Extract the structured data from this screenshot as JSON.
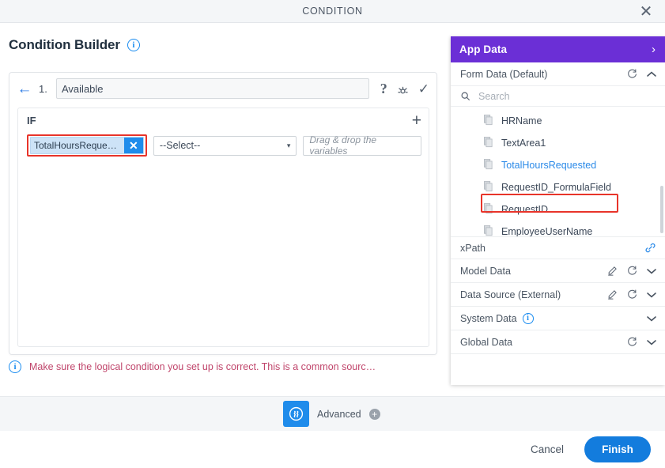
{
  "window": {
    "title": "CONDITION",
    "close_label": "✕"
  },
  "left": {
    "page_title": "Condition Builder",
    "info_icon": "i",
    "condition": {
      "back_icon": "←",
      "index": "1.",
      "name_value": "Available",
      "name_placeholder": "",
      "help_icon": "?",
      "debug_icon": "debug-icon",
      "confirm_icon": "✓",
      "if_label": "IF",
      "add_icon": "+",
      "variable_chip": "TotalHoursReque…",
      "chip_remove": "✕",
      "operator_value": "--Select--",
      "operator_caret": "▾",
      "value_placeholder": "Drag & drop the variables"
    },
    "warning": {
      "icon": "i",
      "text": "Make sure the logical condition you set up is correct. This is a common sourc…"
    }
  },
  "app_data": {
    "header": {
      "title": "App Data",
      "chevron": "›"
    },
    "form_data": {
      "label": "Form Data (Default)",
      "refresh_icon": "refresh-icon",
      "chevron": "⌃",
      "search_placeholder": "Search",
      "search_value": "",
      "items": [
        {
          "label": "HRName",
          "highlighted": false
        },
        {
          "label": "TextArea1",
          "highlighted": false
        },
        {
          "label": "TotalHoursRequested",
          "highlighted": true
        },
        {
          "label": "RequestID_FormulaField",
          "highlighted": false
        },
        {
          "label": "RequestID",
          "highlighted": false
        },
        {
          "label": "EmployeeUserName",
          "highlighted": false
        }
      ]
    },
    "xpath": {
      "label": "xPath",
      "link_icon": "link-icon"
    },
    "sections": [
      {
        "label": "Model Data",
        "has_edit": true,
        "has_refresh": true,
        "has_info": false,
        "chevron": "⌄"
      },
      {
        "label": "Data Source (External)",
        "has_edit": true,
        "has_refresh": true,
        "has_info": false,
        "chevron": "⌄"
      },
      {
        "label": "System Data",
        "has_edit": false,
        "has_refresh": false,
        "has_info": true,
        "chevron": "⌄"
      },
      {
        "label": "Global Data",
        "has_edit": false,
        "has_refresh": true,
        "has_info": false,
        "chevron": "⌄"
      }
    ]
  },
  "bottom": {
    "advanced_label": "Advanced",
    "advanced_plus": "+",
    "cancel_label": "Cancel",
    "finish_label": "Finish"
  },
  "colors": {
    "brand_purple": "#6b2fd6",
    "accent_blue": "#137cdd",
    "highlight_red": "#e8342a",
    "warning_text": "#c0456b"
  }
}
